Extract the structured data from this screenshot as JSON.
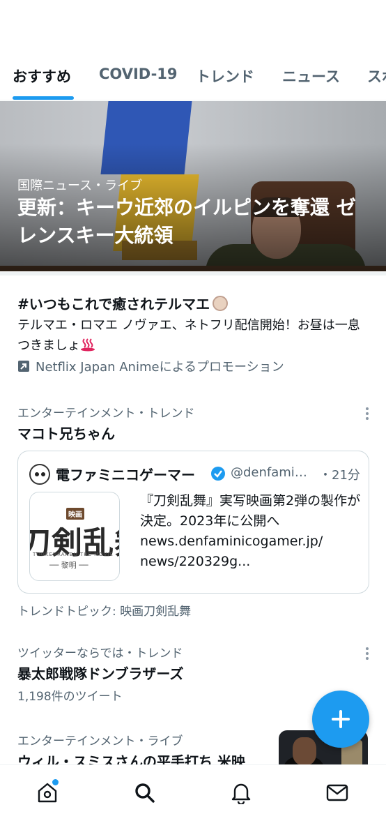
{
  "tabs": [
    {
      "label": "おすすめ",
      "active": true
    },
    {
      "label": "COVID-19",
      "active": false
    },
    {
      "label": "トレンド",
      "active": false
    },
    {
      "label": "ニュース",
      "active": false
    },
    {
      "label": "スポ",
      "active": false
    }
  ],
  "hero": {
    "category": "国際ニュース・ライブ",
    "title": "更新：キーウ近郊のイルピンを奪還 ゼレンスキー大統領"
  },
  "promo": {
    "title": "#いつもこれで癒されテルマエ",
    "description": "テルマエ・ロマエ ノヴァエ、ネトフリ配信開始！お昼は一息つきましょ",
    "promoted_by": "Netflix Japan Animeによるプロモーション"
  },
  "trends": [
    {
      "meta": "エンターテインメント・トレンド",
      "name": "マコト兄ちゃん",
      "card": {
        "author_name": "電ファミニコゲーマー",
        "handle": "@denfaminicogamer",
        "time": "・21分",
        "thumb_badge": "映画",
        "thumb_title": "刀剣乱舞",
        "thumb_subtitle": "TOUKENRANBU THE MOVIE",
        "thumb_subtitle2": "── 黎明 ──",
        "text": "『刀剣乱舞』実写映画第2弾の製作が決定。2023年に公開へ news.denfaminicogamer.jp/ news/220329g..."
      },
      "topic": "トレンドトピック: 映画刀剣乱舞"
    },
    {
      "meta": "ツイッターならでは・トレンド",
      "name": "暴太郎戦隊ドンブラザーズ",
      "count": "1,198件のツイート"
    },
    {
      "meta": "エンターテインメント・ライブ",
      "name": "ウィル・スミスさんの平手打ち 米映"
    }
  ],
  "nav": {
    "home_icon": "home-icon",
    "search_icon": "search-icon",
    "notifications_icon": "bell-icon",
    "messages_icon": "mail-icon"
  },
  "colors": {
    "accent": "#1d9bf0",
    "text": "#0f1419",
    "secondary": "#536471"
  }
}
